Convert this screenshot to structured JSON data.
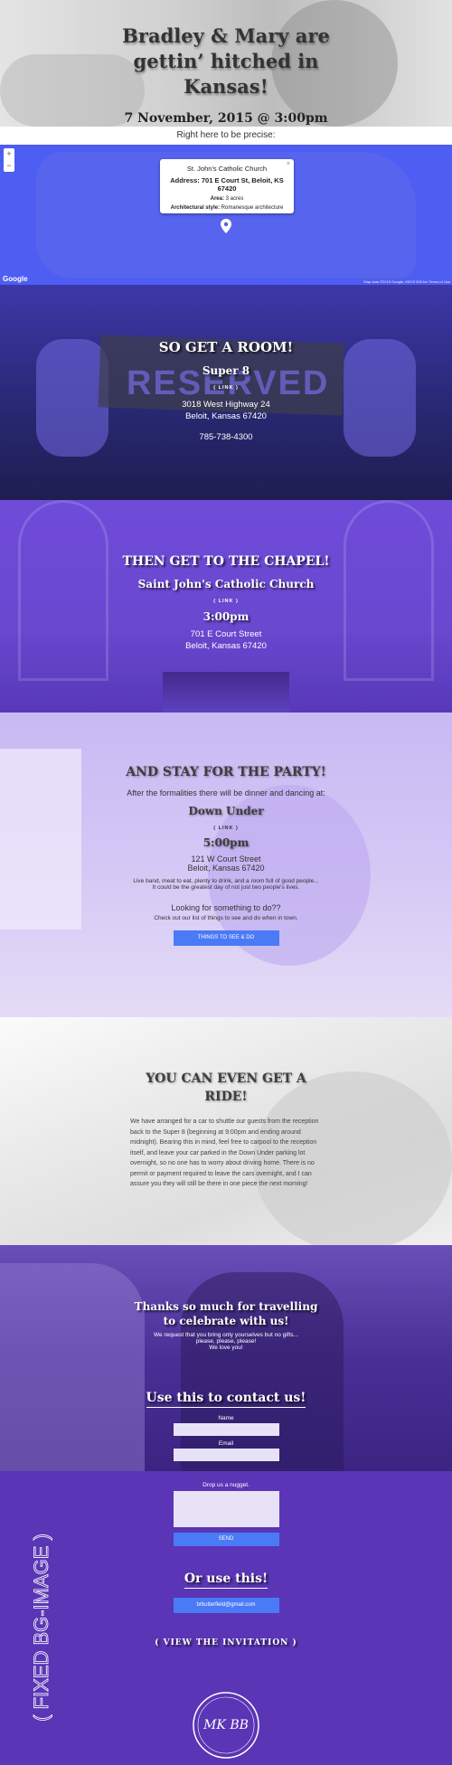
{
  "hero": {
    "title": "Bradley & Mary are gettin’ hitched in Kansas!",
    "date": "7 November, 2015 @ 3:00pm"
  },
  "map": {
    "intro": "Right here to be precise:",
    "zoom_in": "+",
    "zoom_out": "−",
    "info_title": "St. John's Catholic Church",
    "info_address": "Address: 701 E Court St, Beloit, KS 67420",
    "info_area_label": "Area:",
    "info_area_value": "3 acres",
    "info_style_label": "Architectural style:",
    "info_style_value": "Romanesque architecture",
    "close": "×",
    "google": "Google",
    "terms": "Map data ©2015 Google, INEGI   500 km   Terms of Use"
  },
  "room": {
    "heading": "SO GET A ROOM!",
    "sign_text": "RESERVED",
    "venue": "Super 8",
    "link": "( LINK )",
    "address1": "3018 West Highway 24",
    "address2": "Beloit, Kansas 67420",
    "phone": "785-738-4300"
  },
  "chapel": {
    "heading": "THEN GET TO THE CHAPEL!",
    "venue": "Saint John's Catholic Church",
    "link": "( LINK )",
    "time": "3:00pm",
    "address1": "701 E Court Street",
    "address2": "Beloit, Kansas 67420"
  },
  "party": {
    "heading": "AND STAY FOR THE PARTY!",
    "intro": "After the formalities there will be dinner and dancing at:",
    "venue": "Down Under",
    "link": "( LINK )",
    "time": "5:00pm",
    "address1": "121 W Court Street",
    "address2": "Beloit, Kansas 67420",
    "desc1": "Live band, meat to eat, plenty to drink, and a room full of good people...",
    "desc2": "It could be the greatest day of not just two people's lives.",
    "todo_heading": "Looking for something to do??",
    "todo_text": "Check out our list of things to see and do when in town.",
    "todo_button": "THINGS TO SEE & DO"
  },
  "ride": {
    "heading": "YOU CAN EVEN GET A RIDE!",
    "body": "We have arranged for a car to shuttle our guests from the reception back to the Super 8 (beginning at 9:00pm and ending around midnight). Bearing this in mind, feel free to carpool to the reception itself, and leave your car parked in the Down Under parking lot overnight, so no one has to worry about driving home. There is no permit or payment required to leave the cars overnight, and I can assure you they will still be there in one piece the next morning!"
  },
  "thanks": {
    "heading": "Thanks so much for travelling to celebrate with us!",
    "line1": "We request that you bring only yourselves but no gifts...",
    "line2": "please, please, please!",
    "line3": "We love you!"
  },
  "contact": {
    "heading": "Use this to contact us!",
    "name_label": "Name",
    "email_label": "Email",
    "message_label": "Drop us a nugget.",
    "send_button": "SEND",
    "or_heading": "Or use this!",
    "email_button": "brbutterfield@gmail.com",
    "invitation_link": "( VIEW THE INVITATION )",
    "fixed_label": "( FIXED BG-IMAGE )",
    "monogram": "MK BB"
  }
}
